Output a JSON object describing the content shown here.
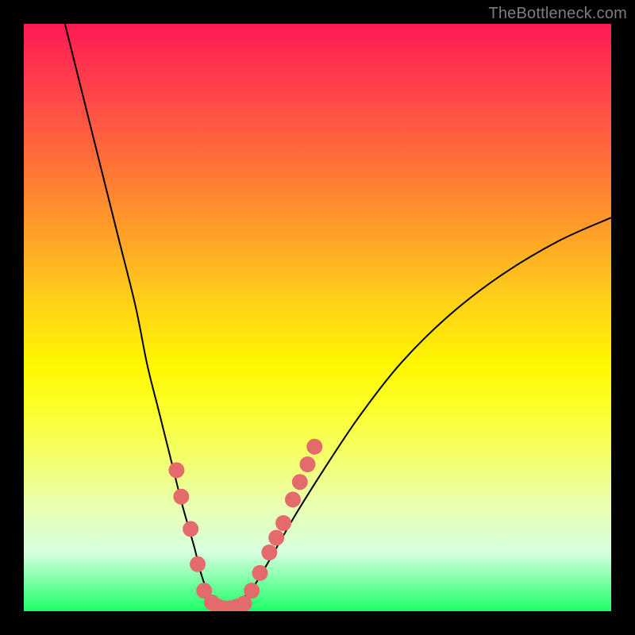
{
  "watermark": {
    "text": "TheBottleneck.com"
  },
  "chart_data": {
    "type": "line",
    "title": "",
    "xlabel": "",
    "ylabel": "",
    "xlim": [
      0,
      100
    ],
    "ylim": [
      0,
      100
    ],
    "series": [
      {
        "name": "bottleneck-curve",
        "x": [
          7,
          10,
          13,
          16,
          19,
          21,
          23,
          25,
          27,
          29,
          30,
          31,
          32,
          33,
          34,
          35,
          36,
          37,
          39,
          42,
          46,
          51,
          57,
          64,
          72,
          81,
          91,
          100
        ],
        "y": [
          100,
          88,
          76,
          64,
          52,
          42,
          34,
          26,
          18,
          11,
          7,
          4,
          2,
          1,
          0,
          0,
          1,
          2,
          4,
          9,
          16,
          24,
          33,
          42,
          50,
          57,
          63,
          67
        ]
      }
    ],
    "markers": [
      {
        "name": "data-points-left",
        "x": [
          26.0,
          26.8,
          28.4,
          29.6,
          30.7,
          32.0
        ],
        "y": [
          24.0,
          19.5,
          14.0,
          8.0,
          3.5,
          1.5
        ]
      },
      {
        "name": "data-points-bottom",
        "x": [
          33.0,
          34.0,
          35.1,
          36.3,
          37.5
        ],
        "y": [
          0.8,
          0.5,
          0.5,
          0.8,
          1.3
        ]
      },
      {
        "name": "data-points-right",
        "x": [
          38.8,
          40.2,
          41.8,
          43.0,
          44.2,
          45.8,
          47.0,
          48.3,
          49.5
        ],
        "y": [
          3.5,
          6.5,
          10.0,
          12.5,
          15.0,
          19.0,
          22.0,
          25.0,
          28.0
        ]
      }
    ],
    "marker_style": {
      "color": "#e46b6b",
      "radius_px": 10
    }
  }
}
